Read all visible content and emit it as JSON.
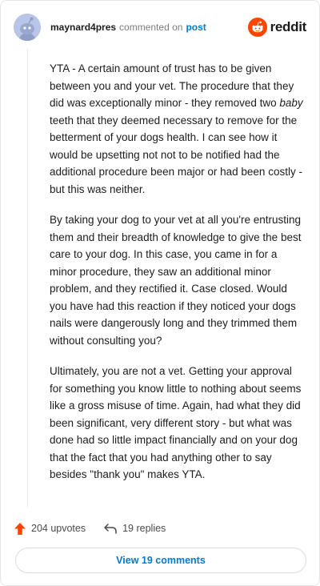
{
  "header": {
    "username": "maynard4pres",
    "action_text": "commented on",
    "post_link": "post",
    "brand_name": "reddit",
    "brand_color": "#ff4500"
  },
  "comment": {
    "p1_a": "YTA - A certain amount of trust has to be given between you and your vet. The procedure that they did was exceptionally minor - they removed two ",
    "p1_em": "baby",
    "p1_b": " teeth that they deemed necessary to remove for the betterment of your dogs health. I can see how it would be upsetting not not to be notified had the additional procedure been major or had been costly - but this was neither.",
    "p2": "By taking your dog to your vet at all you're entrusting them and their breadth of knowledge to give the best care to your dog. In this case, you came in for a minor procedure, they saw an additional minor problem, and they rectified it. Case closed. Would you have had this reaction if they noticed your dogs nails were dangerously long and they trimmed them without consulting you?",
    "p3": "Ultimately, you are not a vet. Getting your approval for something you know little to nothing about seems like a gross misuse of time. Again, had what they did been significant, very different story - but what was done had so little impact financially and on your dog that the fact that you had anything other to say besides \"thank you\" makes YTA."
  },
  "footer": {
    "upvotes": "204 upvotes",
    "replies": "19 replies",
    "upvote_icon": "upvote-arrow-icon",
    "reply_icon": "reply-arrow-icon",
    "upvote_color": "#ff4500"
  },
  "view_button": {
    "label": "View 19 comments"
  }
}
